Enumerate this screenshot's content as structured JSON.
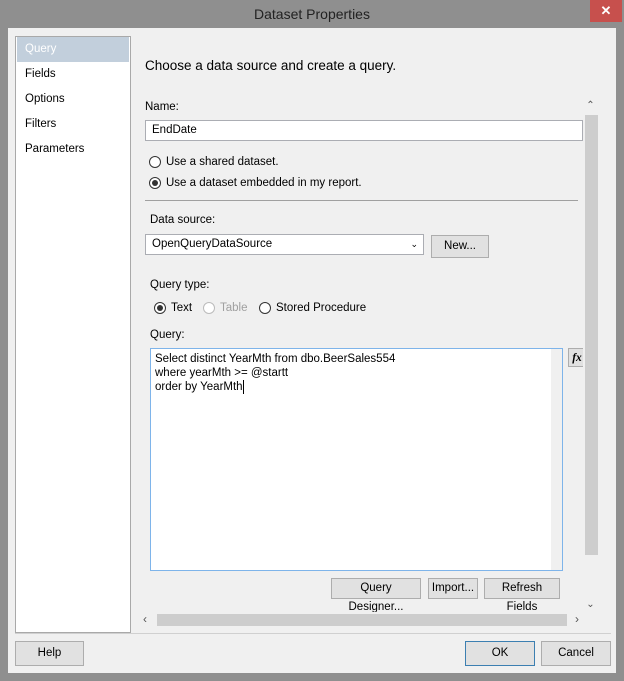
{
  "window": {
    "title": "Dataset Properties",
    "close_icon": "close-icon"
  },
  "sidebar": {
    "items": [
      {
        "label": "Query",
        "selected": true
      },
      {
        "label": "Fields"
      },
      {
        "label": "Options"
      },
      {
        "label": "Filters"
      },
      {
        "label": "Parameters"
      }
    ]
  },
  "main": {
    "heading": "Choose a data source and create a query.",
    "name_label": "Name:",
    "name_value": "EndDate",
    "radio_shared": "Use a shared dataset.",
    "radio_embedded": "Use a dataset embedded in my report.",
    "data_source_label": "Data source:",
    "data_source_value": "OpenQueryDataSource",
    "new_button": "New...",
    "query_type_label": "Query type:",
    "query_type_text": "Text",
    "query_type_table": "Table",
    "query_type_sp": "Stored Procedure",
    "query_label": "Query:",
    "query_lines": [
      "Select distinct YearMth from dbo.BeerSales554",
      "where yearMth >= @startt",
      "order by YearMth"
    ],
    "fx_button": "fx",
    "query_designer_button": "Query Designer...",
    "import_button": "Import...",
    "refresh_fields_button": "Refresh Fields"
  },
  "footer": {
    "help": "Help",
    "ok": "OK",
    "cancel": "Cancel"
  }
}
